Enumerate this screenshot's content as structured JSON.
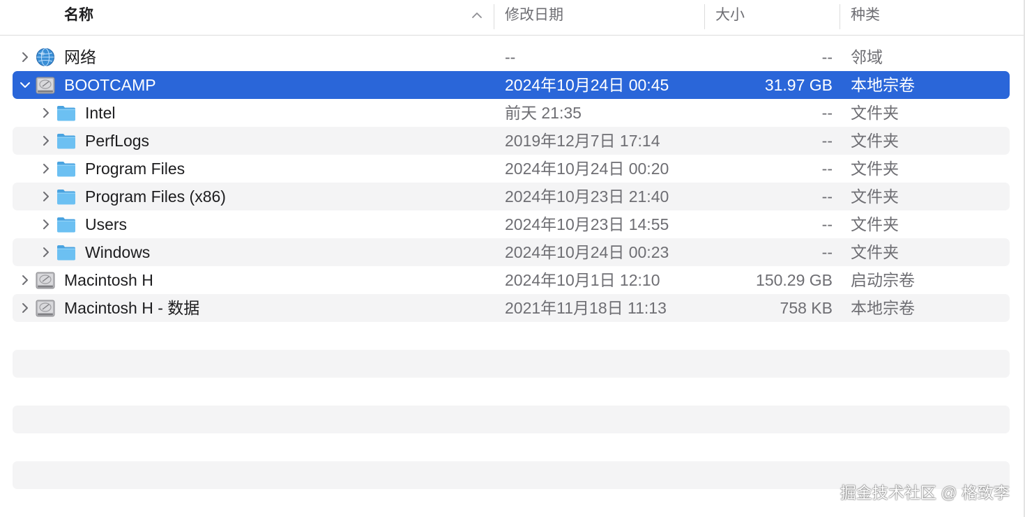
{
  "header": {
    "name_label": "名称",
    "date_label": "修改日期",
    "size_label": "大小",
    "kind_label": "种类",
    "sort_indicator": "chevron-up-icon"
  },
  "rows": [
    {
      "name": "网络",
      "date": "--",
      "size": "--",
      "kind": "邻域",
      "icon": "network-globe-icon",
      "expanded": false,
      "selected": false
    },
    {
      "name": "BOOTCAMP",
      "date": "2024年10月24日 00:45",
      "size": "31.97 GB",
      "kind": "本地宗卷",
      "icon": "hard-drive-icon",
      "expanded": true,
      "selected": true
    },
    {
      "name": "Intel",
      "date": "前天 21:35",
      "size": "--",
      "kind": "文件夹",
      "icon": "folder-icon",
      "expanded": false,
      "selected": false
    },
    {
      "name": "PerfLogs",
      "date": "2019年12月7日 17:14",
      "size": "--",
      "kind": "文件夹",
      "icon": "folder-icon",
      "expanded": false,
      "selected": false
    },
    {
      "name": "Program Files",
      "date": "2024年10月24日 00:20",
      "size": "--",
      "kind": "文件夹",
      "icon": "folder-icon",
      "expanded": false,
      "selected": false
    },
    {
      "name": "Program Files (x86)",
      "date": "2024年10月23日 21:40",
      "size": "--",
      "kind": "文件夹",
      "icon": "folder-icon",
      "expanded": false,
      "selected": false
    },
    {
      "name": "Users",
      "date": "2024年10月23日 14:55",
      "size": "--",
      "kind": "文件夹",
      "icon": "folder-icon",
      "expanded": false,
      "selected": false
    },
    {
      "name": "Windows",
      "date": "2024年10月24日 00:23",
      "size": "--",
      "kind": "文件夹",
      "icon": "folder-icon",
      "expanded": false,
      "selected": false
    },
    {
      "name": "Macintosh H",
      "date": "2024年10月1日 12:10",
      "size": "150.29 GB",
      "kind": "启动宗卷",
      "icon": "hard-drive-icon",
      "expanded": false,
      "selected": false
    },
    {
      "name": "Macintosh H - 数据",
      "date": "2021年11月18日 11:13",
      "size": "758 KB",
      "kind": "本地宗卷",
      "icon": "hard-drive-icon",
      "expanded": false,
      "selected": false
    }
  ],
  "watermark": "掘金技术社区 @ 格致李",
  "colors": {
    "selection": "#2a66d9",
    "stripe": "#f4f4f5",
    "folder": "#5ab3ee",
    "secondary_text": "#6e6e73"
  }
}
